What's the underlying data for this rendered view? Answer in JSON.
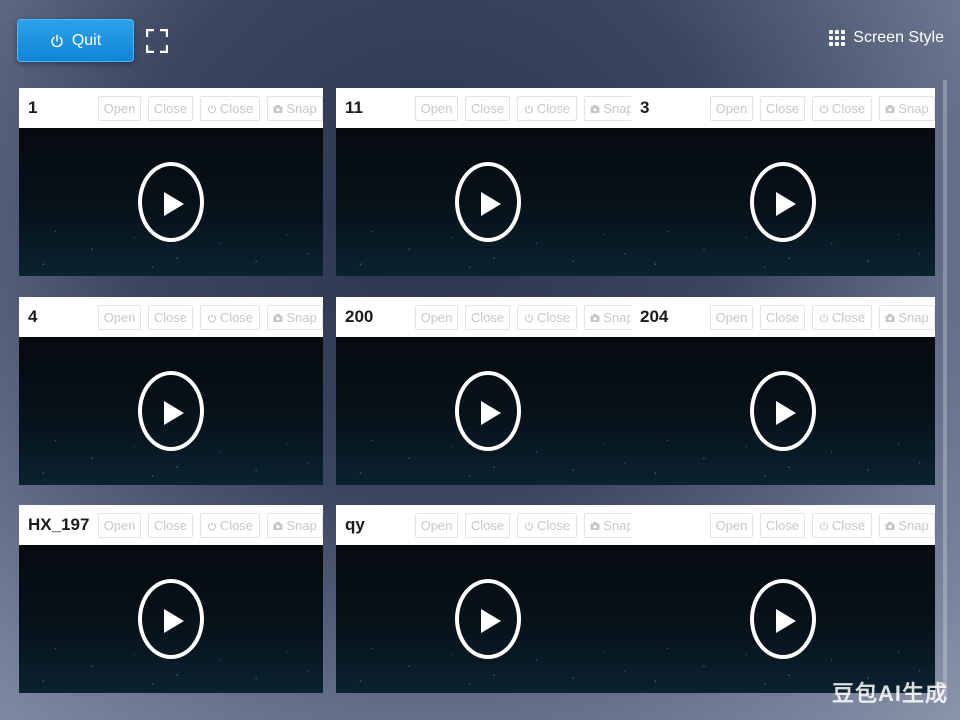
{
  "toolbar": {
    "quit_label": "Quit",
    "screen_style_label": "Screen Style"
  },
  "tiles": [
    {
      "name": "1"
    },
    {
      "name": "11"
    },
    {
      "name": "3"
    },
    {
      "name": "4"
    },
    {
      "name": "200"
    },
    {
      "name": "204"
    },
    {
      "name": "HX_197"
    },
    {
      "name": "qy"
    },
    {
      "name": ""
    }
  ],
  "tile_buttons": {
    "open": "Open",
    "close": "Close",
    "power_close": "Close",
    "snap": "Snap"
  },
  "watermark": "豆包AI生成",
  "colors": {
    "accent": "#1890e8",
    "header_bg": "#ffffff",
    "video_bg": "#07121a"
  }
}
